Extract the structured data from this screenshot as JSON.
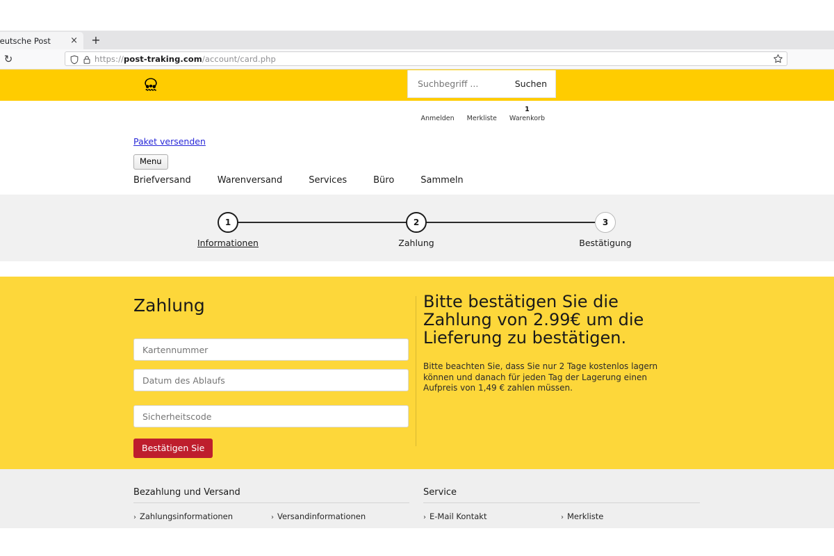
{
  "browser": {
    "tab_title": "et | Deutsche Post",
    "tab_close_glyph": "×",
    "newtab_glyph": "+",
    "reload_glyph": "↻",
    "url_scheme": "https://",
    "url_host": "post-traking.com",
    "url_path": "/account/card.php"
  },
  "header": {
    "logo_name": "deutsche-post-posthorn",
    "search": {
      "placeholder": "Suchbegriff ...",
      "submit_label": "Suchen"
    },
    "meta_nav": [
      {
        "label": "Anmelden",
        "badge": ""
      },
      {
        "label": "Merkliste",
        "badge": ""
      },
      {
        "label": "Warenkorb",
        "badge": "1"
      }
    ]
  },
  "nav": {
    "paket_link": "Paket versenden",
    "menu_button": "Menu",
    "items": [
      {
        "label": "Briefversand"
      },
      {
        "label": "Warenversand"
      },
      {
        "label": "Services"
      },
      {
        "label": "Büro"
      },
      {
        "label": "Sammeln"
      }
    ]
  },
  "stepper": {
    "steps": [
      {
        "number": "1",
        "label": "Informationen",
        "state": "done"
      },
      {
        "number": "2",
        "label": "Zahlung",
        "state": "active"
      },
      {
        "number": "3",
        "label": "Bestätigung",
        "state": "inactive"
      }
    ]
  },
  "payment": {
    "title": "Zahlung",
    "fields": [
      {
        "placeholder": "Kartennummer"
      },
      {
        "placeholder": "Datum des Ablaufs"
      },
      {
        "placeholder": "Sicherheitscode"
      }
    ],
    "submit_label": "Bestätigen Sie",
    "heading": "Bitte bestätigen Sie die Zahlung von 2.99€ um die Lieferung zu bestätigen.",
    "note": "Bitte beachten Sie, dass Sie nur 2 Tage kostenlos lagern können und danach für jeden Tag der Lagerung einen Aufpreis von 1,49 € zahlen müssen.",
    "amount": "2.99€",
    "storage_fee": "1,49 €",
    "free_storage_days": "2"
  },
  "footer": {
    "columns": [
      {
        "heading": "Bezahlung und Versand",
        "links": [
          {
            "label": "Zahlungsinformationen"
          },
          {
            "label": "Versandinformationen"
          }
        ]
      },
      {
        "heading": "Service",
        "links": [
          {
            "label": "E-Mail Kontakt"
          },
          {
            "label": "Merkliste"
          }
        ]
      }
    ],
    "chevron_glyph": "›"
  },
  "colors": {
    "brand_yellow": "#FFCC00",
    "content_yellow": "#FDD73A",
    "confirm_red": "#BE1E2D",
    "band_grey": "#F1F1F1",
    "footer_grey": "#EFEFEF",
    "link_blue": "#2727D8"
  }
}
